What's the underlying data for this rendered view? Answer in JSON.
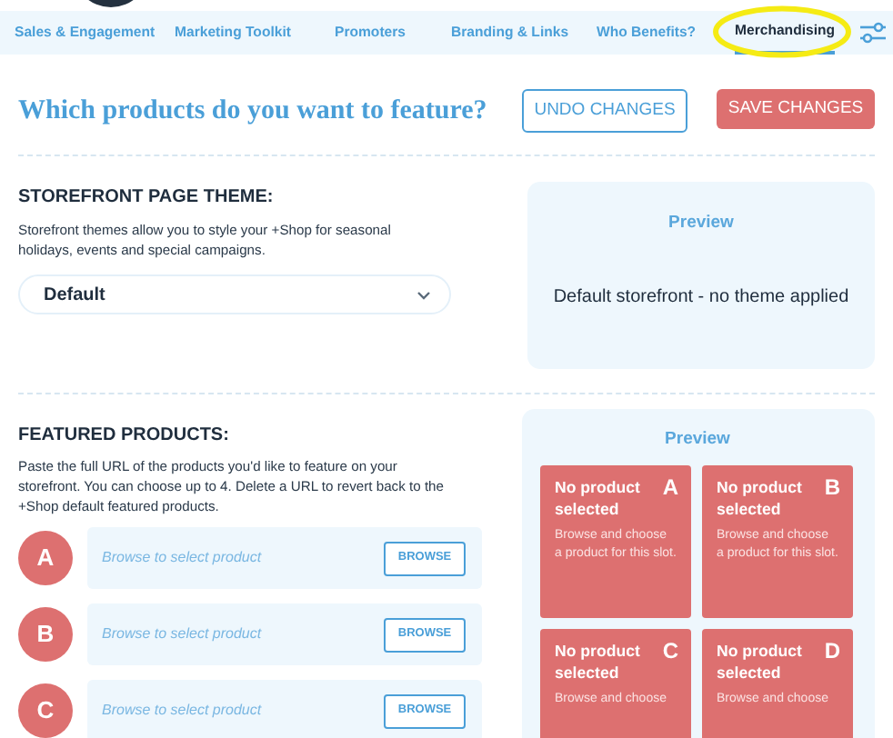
{
  "nav": {
    "tabs": [
      {
        "label": "Sales & Engagement",
        "selected": false
      },
      {
        "label": "Marketing Toolkit",
        "selected": false
      },
      {
        "label": "Promoters",
        "selected": false
      },
      {
        "label": "Branding & Links",
        "selected": false
      },
      {
        "label": "Who Benefits?",
        "selected": false
      },
      {
        "label": "Merchandising",
        "selected": true
      }
    ]
  },
  "header": {
    "title": "Which products do you want to feature?",
    "buttons": [
      {
        "label": "UNDO CHANGES",
        "kind": "outline"
      },
      {
        "label": "SAVE CHANGES",
        "kind": "primary"
      }
    ]
  },
  "theme": {
    "title": "STOREFRONT PAGE THEME:",
    "description": "Storefront themes allow you to style your +Shop for seasonal holidays, events and special campaigns.",
    "select": {
      "value": "Default"
    },
    "preview": {
      "title": "Preview",
      "text": "Default storefront - no theme applied"
    }
  },
  "featured": {
    "title": "FEATURED PRODUCTS:",
    "description": "Paste the full URL of the products you'd like to feature on your storefront. You can choose up to 4. Delete a URL to revert back to the +Shop default featured products.",
    "slots": [
      {
        "letter": "A",
        "placeholder": "Browse to select product",
        "button": "BROWSE"
      },
      {
        "letter": "B",
        "placeholder": "Browse to select product",
        "button": "BROWSE"
      },
      {
        "letter": "C",
        "placeholder": "Browse to select product",
        "button": "BROWSE"
      }
    ],
    "preview": {
      "title": "Preview",
      "cards": [
        {
          "letter": "A",
          "title": "No product selected",
          "text": "Browse and choose a product for this slot."
        },
        {
          "letter": "B",
          "title": "No product selected",
          "text": "Browse and choose a product for this slot."
        },
        {
          "letter": "C",
          "title": "No product selected",
          "text": "Browse and choose"
        },
        {
          "letter": "D",
          "title": "No product selected",
          "text": "Browse and choose"
        }
      ]
    }
  }
}
